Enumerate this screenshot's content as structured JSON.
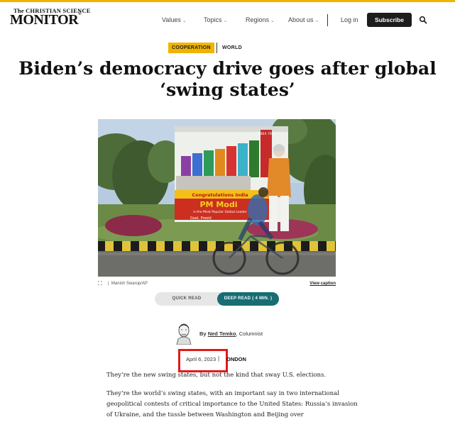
{
  "header": {
    "logo_small": "The CHRISTIAN SCIENCE",
    "logo_main": "MONITOR",
    "logo_mark": "®",
    "nav": [
      {
        "label": "Values"
      },
      {
        "label": "Topics"
      },
      {
        "label": "Regions"
      },
      {
        "label": "About us"
      }
    ],
    "login": "Log in",
    "subscribe": "Subscribe",
    "accent_color": "#f0b400"
  },
  "article": {
    "category": "COOPERATION",
    "section": "WORLD",
    "headline": "Biden’s democracy drive goes after global ‘swing states’",
    "photo": {
      "billboard_top_label": "INDIA 78%",
      "billboard_banner": "Congratulations India",
      "billboard_name": "PM Modi",
      "billboard_sub": "is the Most Popular Global Leader",
      "billboard_goel": "Goel, Presid",
      "credit": "Manish Swarup/AP",
      "view_caption": "View caption"
    },
    "toggle": {
      "quick": "QUICK READ",
      "deep": "DEEP READ ( 4 MIN. )"
    },
    "byline": {
      "by": "By",
      "author": "Ned Temko",
      "role": ", Columnist"
    },
    "dateline": {
      "date": "April 6, 2023",
      "separator": "|",
      "location": "ONDON"
    },
    "paragraphs": [
      "They’re the new swing states, but not the kind that sway U.S. elections.",
      "They’re the world’s swing states, with an important say in two international geopolitical contests of critical importance to the United States: Russia’s invasion of Ukraine, and the tussle between Washington and Beijing over"
    ]
  }
}
